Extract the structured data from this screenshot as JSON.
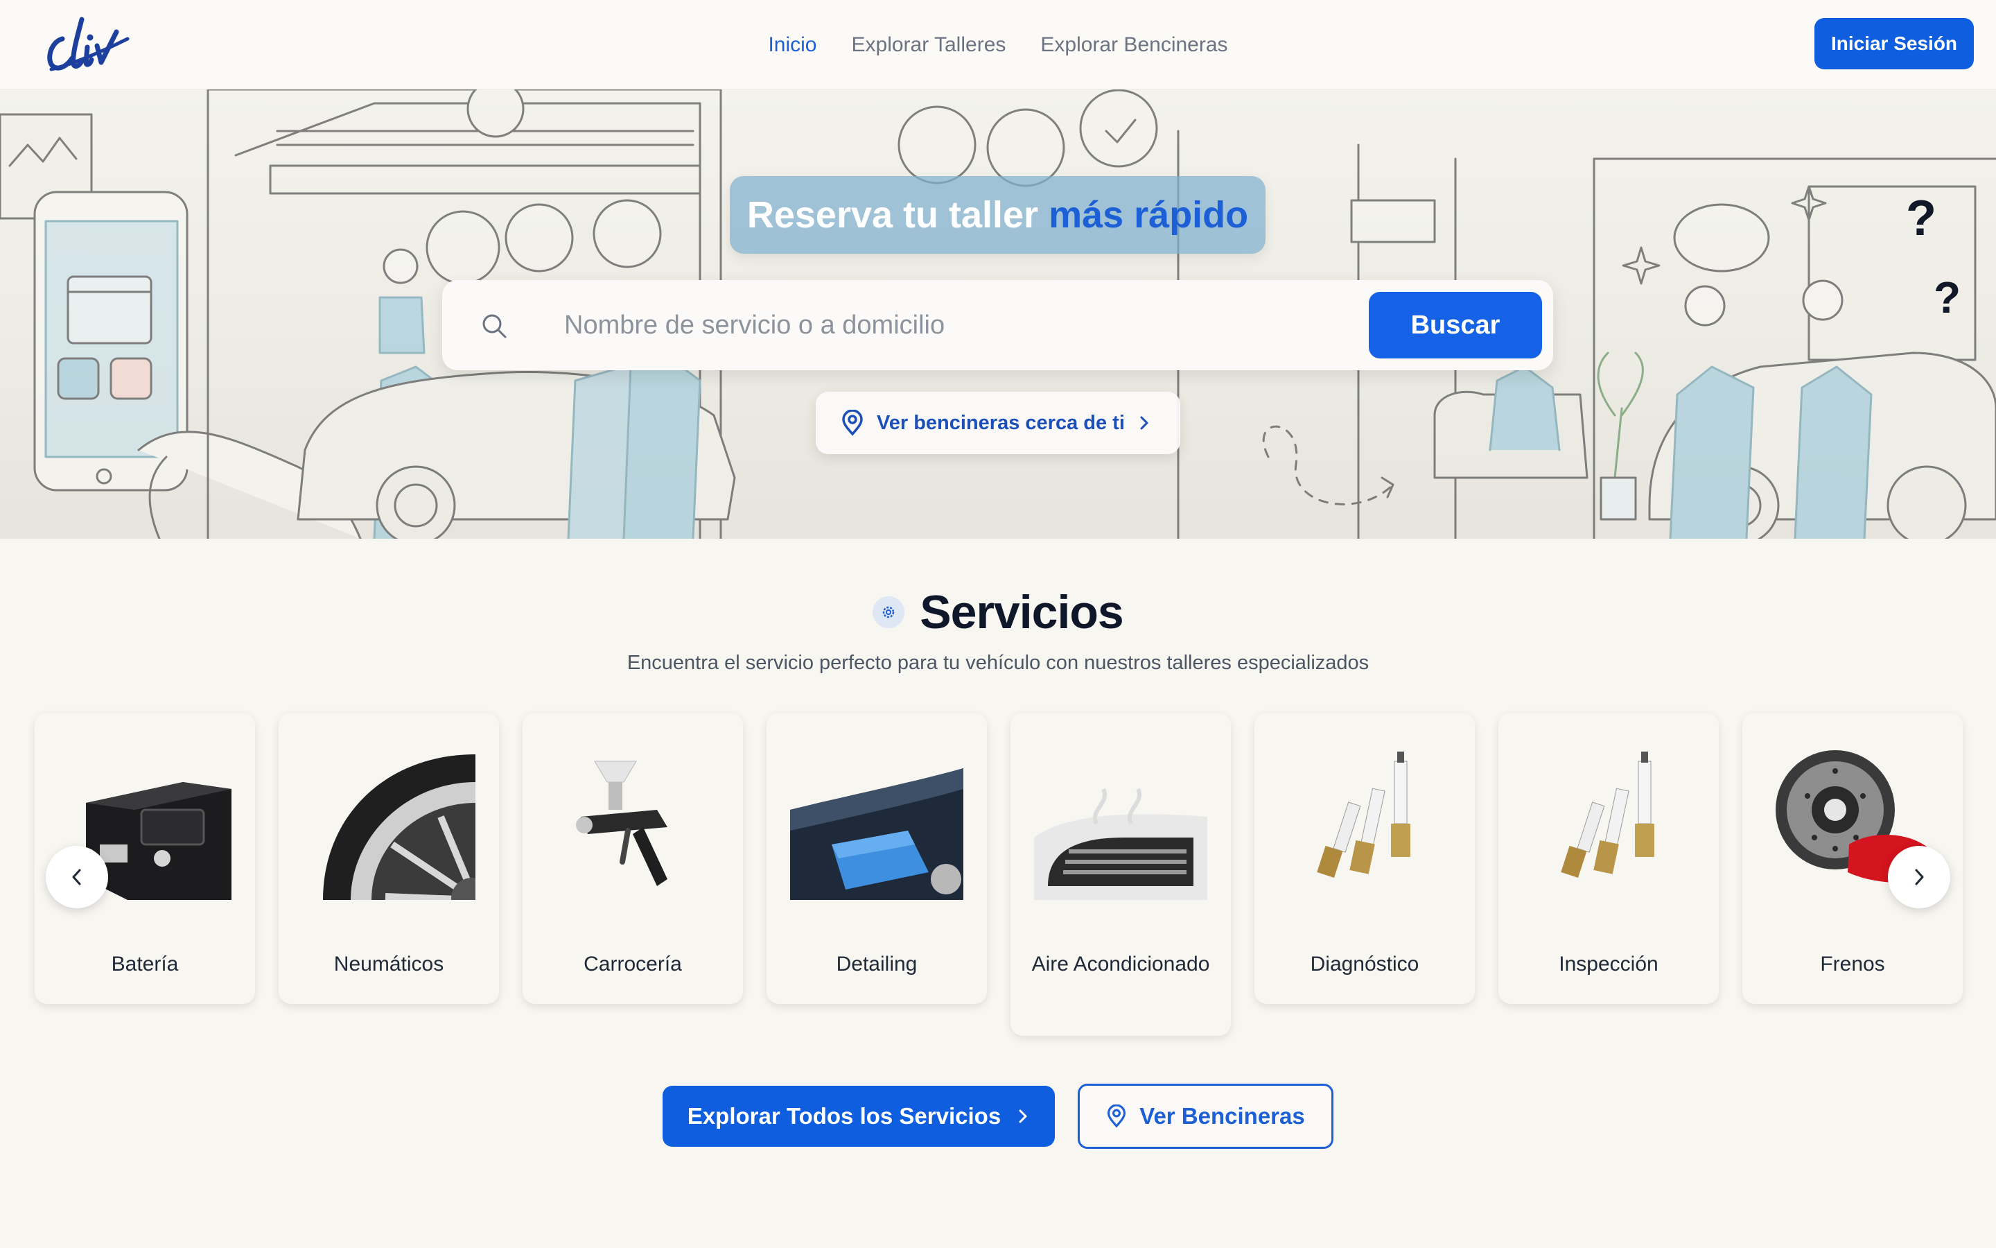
{
  "brand": {
    "logo_text": "cliv",
    "color": "#1d3f9e"
  },
  "nav": {
    "links": [
      {
        "label": "Inicio",
        "active": true
      },
      {
        "label": "Explorar Talleres",
        "active": false
      },
      {
        "label": "Explorar Bencineras",
        "active": false
      }
    ],
    "login_label": "Iniciar Sesión"
  },
  "hero": {
    "title_main": "Reserva tu taller ",
    "title_accent": "más rápido",
    "search": {
      "placeholder": "Nombre de servicio o a domicilio",
      "value": "",
      "button_label": "Buscar",
      "icon": "search-icon"
    },
    "nearby": {
      "label": "Ver bencineras cerca de ti",
      "icon": "map-pin-icon"
    }
  },
  "services": {
    "title": "Servicios",
    "subtitle": "Encuentra el servicio perfecto para tu vehículo con nuestros talleres especializados",
    "items": [
      {
        "label": "Batería",
        "icon": "battery-image"
      },
      {
        "label": "Neumáticos",
        "icon": "tire-image"
      },
      {
        "label": "Carrocería",
        "icon": "spray-gun-image"
      },
      {
        "label": "Detailing",
        "icon": "microfiber-cloth-image"
      },
      {
        "label": "Aire Acondicionado",
        "icon": "air-vent-image"
      },
      {
        "label": "Diagnóstico",
        "icon": "spark-plugs-image"
      },
      {
        "label": "Inspección",
        "icon": "spark-plugs-image"
      },
      {
        "label": "Frenos",
        "icon": "brake-disc-image"
      }
    ]
  },
  "cta": {
    "explore_all_label": "Explorar Todos los Servicios",
    "stations_label": "Ver Bencineras"
  },
  "colors": {
    "primary": "#0f5ee0",
    "accent_text": "#1d5fd6",
    "background": "#f8f6f1",
    "hero_title_box": "#7fb0ce"
  }
}
